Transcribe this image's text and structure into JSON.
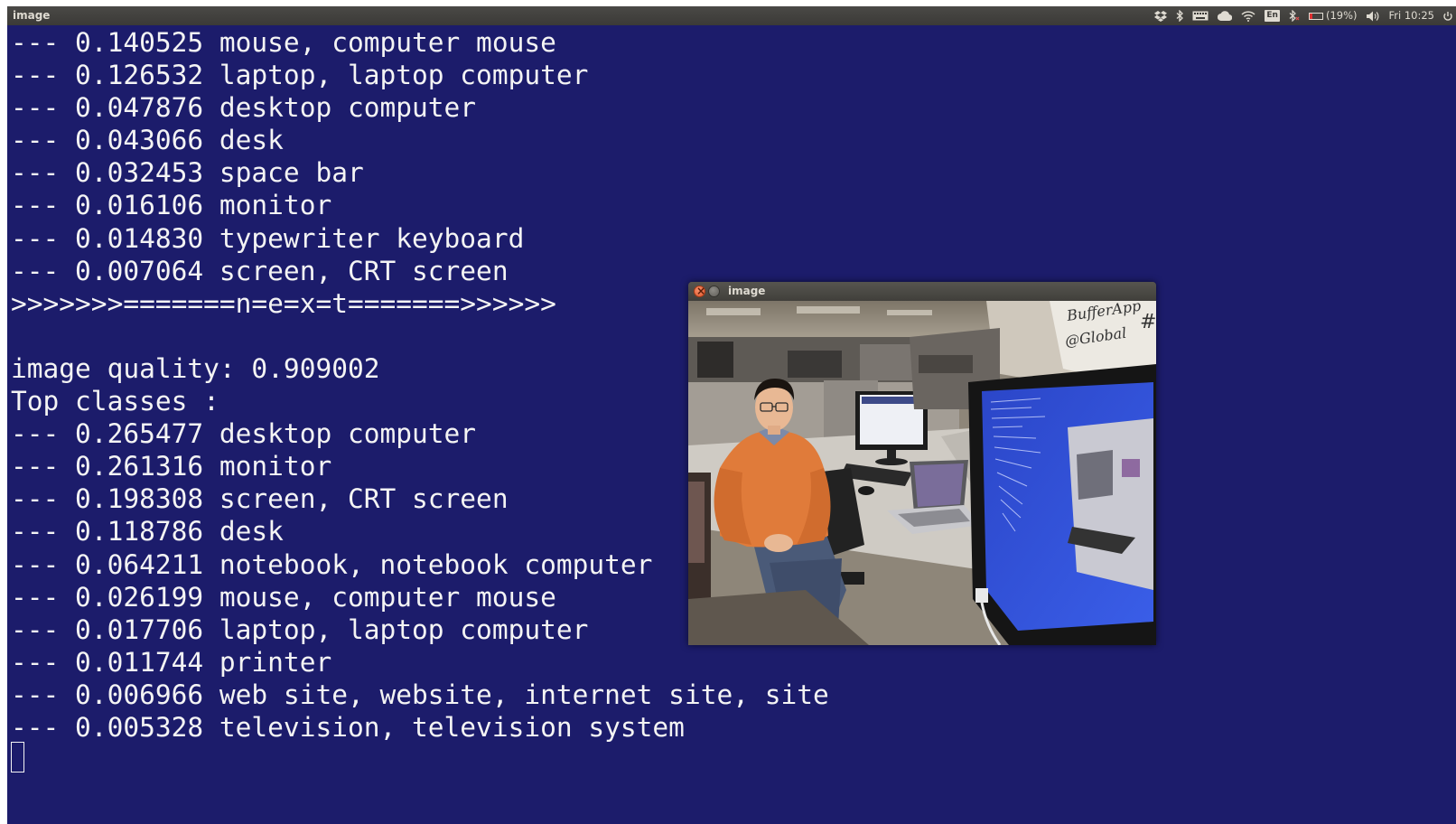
{
  "top_panel": {
    "app_title": "image",
    "battery_text": "(19%)",
    "battery_level": 0.19,
    "language": "En",
    "clock": "Fri 10:25",
    "indicator_icons": [
      "dropbox-icon",
      "bluetooth-icon",
      "keyboard-icon",
      "cloud-icon",
      "wifi-icon",
      "language-indicator",
      "bluetooth-off-icon",
      "battery-icon",
      "volume-icon",
      "power-icon"
    ]
  },
  "terminal": {
    "lines": [
      "--- 0.140525 mouse, computer mouse",
      "--- 0.126532 laptop, laptop computer",
      "--- 0.047876 desktop computer",
      "--- 0.043066 desk",
      "--- 0.032453 space bar",
      "--- 0.016106 monitor",
      "--- 0.014830 typewriter keyboard",
      "--- 0.007064 screen, CRT screen",
      ">>>>>>>=======n=e=x=t=======>>>>>>",
      "",
      "image quality: 0.909002",
      "Top classes :",
      "--- 0.265477 desktop computer",
      "--- 0.261316 monitor",
      "--- 0.198308 screen, CRT screen",
      "--- 0.118786 desk",
      "--- 0.064211 notebook, notebook computer",
      "--- 0.026199 mouse, computer mouse",
      "--- 0.017706 laptop, laptop computer",
      "--- 0.011744 printer",
      "--- 0.006966 web site, website, internet site, site",
      "--- 0.005328 television, television system"
    ]
  },
  "image_window": {
    "title": "image",
    "whiteboard_text_1": "BufferApp",
    "whiteboard_text_2": "@Global",
    "whiteboard_text_3": "#"
  },
  "colors": {
    "terminal_bg": "#1c1c6b",
    "terminal_fg": "#f4f4f4",
    "panel_bg": "#3b3a37",
    "close_button": "#e0552b"
  }
}
